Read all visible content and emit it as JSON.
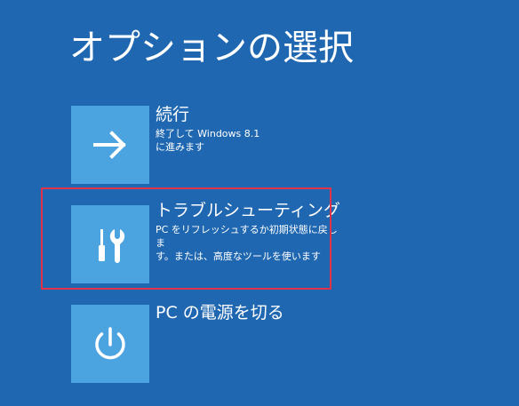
{
  "page": {
    "title": "オプションの選択"
  },
  "options": [
    {
      "label": "続行",
      "description": "終了して Windows 8.1\nに進みます",
      "icon": "arrow-right-icon"
    },
    {
      "label": "トラブルシューティング",
      "description": "PC をリフレッシュするか初期状態に戻しま\nす。または、高度なツールを使います",
      "icon": "tools-icon"
    },
    {
      "label": "PC の電源を切る",
      "description": "",
      "icon": "power-icon"
    }
  ],
  "colors": {
    "background": "#1f67b1",
    "tile": "#4ba3df",
    "text": "#ffffff",
    "highlight": "#e0334a"
  }
}
